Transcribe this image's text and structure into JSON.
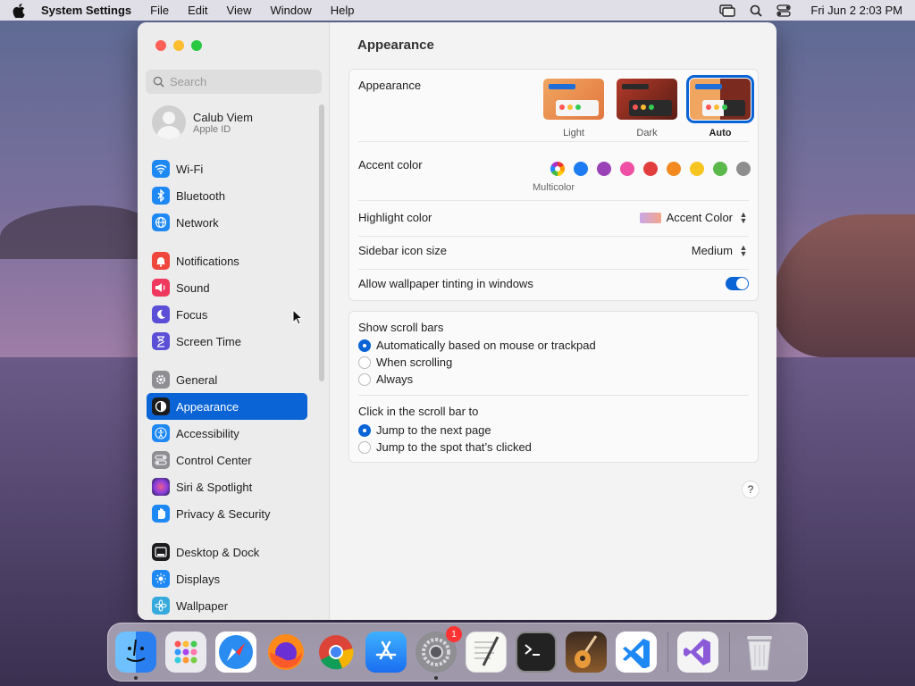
{
  "menubar": {
    "app_name": "System Settings",
    "menus": [
      "File",
      "Edit",
      "View",
      "Window",
      "Help"
    ],
    "clock": "Fri Jun 2  2:03 PM"
  },
  "sidebar": {
    "search_placeholder": "Search",
    "profile": {
      "name": "Calub Viem",
      "subtitle": "Apple ID"
    },
    "items": [
      {
        "label": "Wi-Fi",
        "icon": "wifi-icon",
        "color": "#1e88f5"
      },
      {
        "label": "Bluetooth",
        "icon": "bluetooth-icon",
        "color": "#1e88f5"
      },
      {
        "label": "Network",
        "icon": "globe-icon",
        "color": "#1e88f5"
      },
      {
        "label": "Notifications",
        "icon": "bell-icon",
        "color": "#f0473c"
      },
      {
        "label": "Sound",
        "icon": "speaker-icon",
        "color": "#f0375d"
      },
      {
        "label": "Focus",
        "icon": "moon-icon",
        "color": "#5a4fd6"
      },
      {
        "label": "Screen Time",
        "icon": "hourglass-icon",
        "color": "#5a4fd6"
      },
      {
        "label": "General",
        "icon": "gear-icon",
        "color": "#8e8e93"
      },
      {
        "label": "Appearance",
        "icon": "appearance-icon",
        "color": "#1c1c1e"
      },
      {
        "label": "Accessibility",
        "icon": "accessibility-icon",
        "color": "#1e88f5"
      },
      {
        "label": "Control Center",
        "icon": "toggles-icon",
        "color": "#8e8e93"
      },
      {
        "label": "Siri & Spotlight",
        "icon": "siri-icon",
        "color": "#b04fd6"
      },
      {
        "label": "Privacy & Security",
        "icon": "hand-icon",
        "color": "#1e88f5"
      },
      {
        "label": "Desktop & Dock",
        "icon": "dock-icon",
        "color": "#1c1c1e"
      },
      {
        "label": "Displays",
        "icon": "sun-icon",
        "color": "#1e88f5"
      },
      {
        "label": "Wallpaper",
        "icon": "flower-icon",
        "color": "#36aadc"
      }
    ],
    "selected": "Appearance"
  },
  "main": {
    "title": "Appearance",
    "appearance": {
      "label": "Appearance",
      "options": [
        "Light",
        "Dark",
        "Auto"
      ],
      "selected": "Auto"
    },
    "accent": {
      "label": "Accent color",
      "caption": "Multicolor",
      "colors": [
        "multicolor",
        "#1e7cf2",
        "#9a42b8",
        "#ef4fa4",
        "#e23d3d",
        "#f28a1f",
        "#f7c520",
        "#5bb84a",
        "#8e8e8e"
      ]
    },
    "highlight": {
      "label": "Highlight color",
      "value": "Accent Color"
    },
    "sidebar_icon": {
      "label": "Sidebar icon size",
      "value": "Medium"
    },
    "tinting": {
      "label": "Allow wallpaper tinting in windows",
      "on": true
    },
    "scroll_bars": {
      "label": "Show scroll bars",
      "options": [
        "Automatically based on mouse or trackpad",
        "When scrolling",
        "Always"
      ],
      "selected_index": 0
    },
    "click_scroll": {
      "label": "Click in the scroll bar to",
      "options": [
        "Jump to the next page",
        "Jump to the spot that’s clicked"
      ],
      "selected_index": 0
    },
    "help_label": "?"
  },
  "dock": {
    "apps": [
      {
        "name": "Finder",
        "color": "#3a8ef5"
      },
      {
        "name": "Launchpad",
        "color": "#e9e9ee"
      },
      {
        "name": "Safari",
        "color": "#2a8cf0"
      },
      {
        "name": "Firefox",
        "color": "#ff7a1a"
      },
      {
        "name": "Chrome",
        "color": "#ffffff"
      },
      {
        "name": "App Store",
        "color": "#1e8cf5"
      },
      {
        "name": "System Settings",
        "color": "#8e8e93",
        "badge": "1"
      },
      {
        "name": "TextEdit",
        "color": "#f4f4f4"
      },
      {
        "name": "Terminal",
        "color": "#222222"
      },
      {
        "name": "GarageBand",
        "color": "#8b5a2b"
      },
      {
        "name": "VS Code",
        "color": "#ffffff"
      },
      {
        "name": "Visual Studio",
        "color": "#f4f4f4"
      },
      {
        "name": "Trash",
        "color": "#e6e6ea"
      }
    ]
  }
}
